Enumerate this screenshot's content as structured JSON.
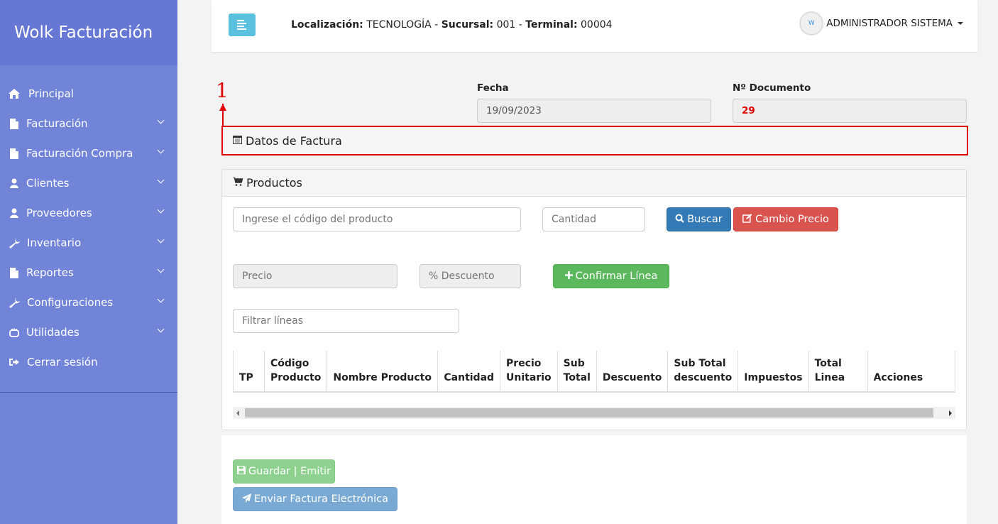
{
  "sidebar": {
    "brand": "Wolk Facturación",
    "items": [
      {
        "label": "Principal",
        "icon": "home-icon",
        "has_submenu": false
      },
      {
        "label": "Facturación",
        "icon": "file-icon",
        "has_submenu": true
      },
      {
        "label": "Facturación Compra",
        "icon": "file-icon",
        "has_submenu": true
      },
      {
        "label": "Clientes",
        "icon": "user-icon",
        "has_submenu": true
      },
      {
        "label": "Proveedores",
        "icon": "user-icon",
        "has_submenu": true
      },
      {
        "label": "Inventario",
        "icon": "wrench-icon",
        "has_submenu": true
      },
      {
        "label": "Reportes",
        "icon": "file-icon",
        "has_submenu": true
      },
      {
        "label": "Configuraciones",
        "icon": "wrench-icon",
        "has_submenu": true
      },
      {
        "label": "Utilidades",
        "icon": "hand-icon",
        "has_submenu": true
      },
      {
        "label": "Cerrar sesión",
        "icon": "sign-out-icon",
        "has_submenu": false
      }
    ]
  },
  "topbar": {
    "localizacion_label": "Localización:",
    "localizacion_value": "TECNOLOGÍA",
    "sucursal_label": "Sucursal:",
    "sucursal_value": "001",
    "terminal_label": "Terminal:",
    "terminal_value": "00004",
    "separator": " - ",
    "user_name": "ADMINISTRADOR SISTEMA",
    "avatar_text": "W"
  },
  "header": {
    "fecha_label": "Fecha",
    "fecha_value": "19/09/2023",
    "documento_label": "Nº Documento",
    "documento_value": "29"
  },
  "annotation": {
    "number": "1"
  },
  "datos_factura": {
    "title": "Datos de Factura"
  },
  "productos": {
    "title": "Productos",
    "codigo_placeholder": "Ingrese el código del producto",
    "cantidad_placeholder": "Cantidad",
    "buscar_label": "Buscar",
    "cambio_precio_label": "Cambio Precio",
    "precio_placeholder": "Precio",
    "descuento_placeholder": "% Descuento",
    "confirmar_label": "Confirmar Línea",
    "filtrar_placeholder": "Filtrar líneas",
    "columns": [
      "TP",
      "Código Producto",
      "Nombre Producto",
      "Cantidad",
      "Precio Unitario",
      "Sub Total",
      "Descuento",
      "Sub Total descuento",
      "Impuestos",
      "Total Linea",
      "Acciones"
    ]
  },
  "actions": {
    "guardar_label": "Guardar | Emitir",
    "enviar_label": "Enviar Factura Electrónica"
  },
  "colors": {
    "sidebar": "#7284d8",
    "brand": "#6678d3",
    "annotation": "#e00000",
    "primary": "#337ab7",
    "danger": "#d9534f",
    "success": "#5cb85c",
    "info": "#5bc0de"
  }
}
